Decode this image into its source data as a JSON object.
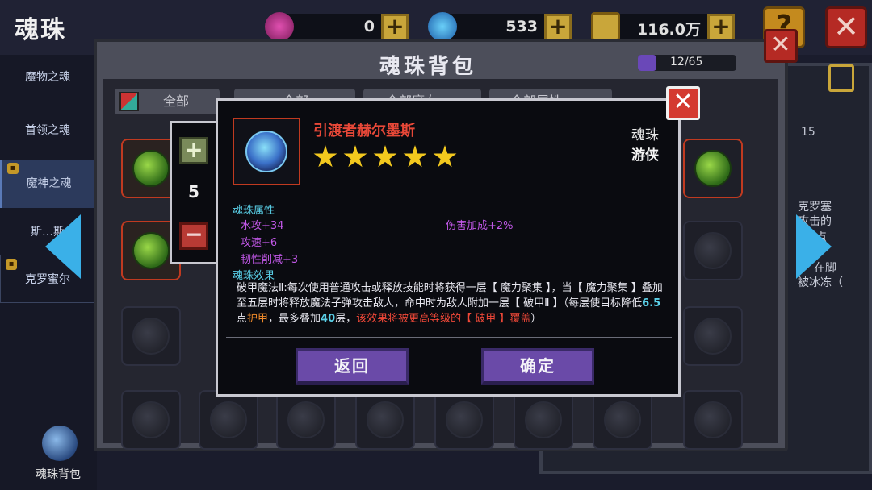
{
  "header": {
    "title": "魂珠",
    "resources": [
      {
        "icon": "pink-gem-icon",
        "value": "0"
      },
      {
        "icon": "blue-gem-icon",
        "value": "533"
      },
      {
        "icon": "gold-chest-icon",
        "value": "116.0万"
      }
    ],
    "help_label": "?",
    "close_label": "✕"
  },
  "sidebar": {
    "items": [
      {
        "label": "魔物之魂",
        "locked": false
      },
      {
        "label": "首领之魂",
        "locked": false
      },
      {
        "label": "魔神之魂",
        "locked": true,
        "selected": true
      },
      {
        "label": "斯…斯",
        "locked": false
      },
      {
        "label": "克罗蜜尔",
        "locked": true
      }
    ],
    "bag_label": "魂珠背包"
  },
  "right_panel": {
    "number": "15",
    "lines": [
      "克罗塞",
      "攻击的",
      "点",
      "在脚",
      "被冰冻（"
    ]
  },
  "bag": {
    "title": "魂珠背包",
    "capacity": "12/65",
    "capacity_ratio": 0.185,
    "close_label": "✕",
    "filters": [
      "全部",
      "全部",
      "全部魔女",
      "全部属性"
    ]
  },
  "detail": {
    "close_label": "✕",
    "quantity": "5",
    "plus_label": "+",
    "minus_label": "−",
    "name": "引渡者赫尔墨斯",
    "stars": 5,
    "type": "魂珠",
    "class": "游侠",
    "attr_heading": "魂珠属性",
    "attrs": [
      {
        "text": "水攻+34"
      },
      {
        "text": "伤害加成+2%"
      },
      {
        "text": "攻速+6"
      },
      {
        "text": "韧性削减+3"
      }
    ],
    "effect_heading": "魂珠效果",
    "effect": {
      "p1": "破甲魔法Ⅱ:每次使用普通攻击或释放技能时将获得一层【 魔力聚集 】，当【 魔力聚集 】叠加至五层时将释放魔法子弹攻击敌人，命中时为敌人附加一层【 破甲Ⅱ 】（每层使目标降低",
      "num1": "6.5",
      "p2": "点",
      "armor": "护甲",
      "p3": "，最多叠加",
      "num2": "40",
      "p4": "层，",
      "red": "该效果将被更高等级的【 破甲 】覆盖",
      "p5": "）"
    },
    "back_label": "返回",
    "confirm_label": "确定"
  },
  "colors": {
    "accent_purple": "#6a4aa8",
    "name_red": "#e84838",
    "star_gold": "#f2c81e",
    "heading_cyan": "#5ad0e8",
    "attr_purple": "#c258e8",
    "arrow_blue": "#3ab0e8"
  }
}
